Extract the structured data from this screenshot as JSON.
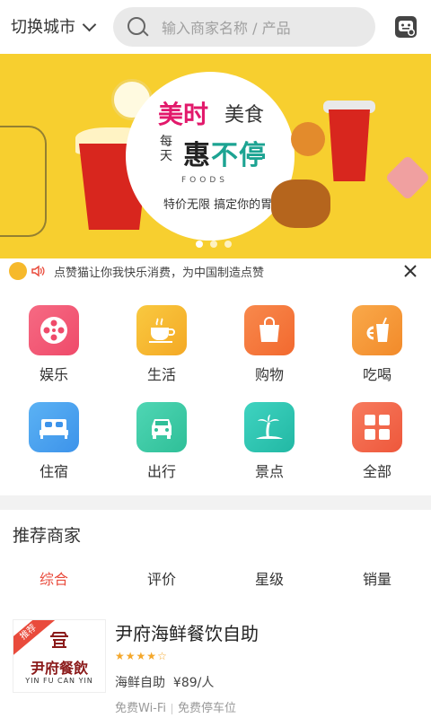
{
  "header": {
    "city_label": "切换城市",
    "search_placeholder": "输入商家名称 / 产品"
  },
  "banner": {
    "line1_red": "美时",
    "line1_black": "美食",
    "line2_small": "每天",
    "line2_black": "惠",
    "line2_teal": "不停",
    "foods": "FOODS",
    "slogan": "特价无限 搞定你的胃",
    "slide_count": 3,
    "active_slide": 1
  },
  "notice": {
    "text": "点赞猫让你我快乐消费，为中国制造点赞"
  },
  "categories": [
    {
      "label": "娱乐",
      "icon": "film-reel-icon",
      "color": "#f15b75"
    },
    {
      "label": "生活",
      "icon": "coffee-cup-icon",
      "color": "#f6b92b"
    },
    {
      "label": "购物",
      "icon": "shopping-bag-icon",
      "color": "#f47c3c"
    },
    {
      "label": "吃喝",
      "icon": "drink-icon",
      "color": "#f59a3a"
    },
    {
      "label": "住宿",
      "icon": "bed-icon",
      "color": "#4aa3f0"
    },
    {
      "label": "出行",
      "icon": "car-icon",
      "color": "#3cc9a6"
    },
    {
      "label": "景点",
      "icon": "palm-tree-icon",
      "color": "#2ec6b1"
    },
    {
      "label": "全部",
      "icon": "grid-icon",
      "color": "#f26b4e"
    }
  ],
  "recommend": {
    "title": "推荐商家",
    "tabs": [
      "综合",
      "评价",
      "星级",
      "销量"
    ],
    "active_tab": 0
  },
  "merchant": {
    "ribbon": "推荐",
    "logo_cn": "尹府餐飲",
    "logo_en": "YIN FU CAN YIN",
    "name": "尹府海鲜餐饮自助",
    "rating": 4,
    "rating_max": 5,
    "category": "海鲜自助",
    "price": "¥89/人",
    "tag1": "免费Wi-Fi",
    "tag2": "免费停车位"
  }
}
